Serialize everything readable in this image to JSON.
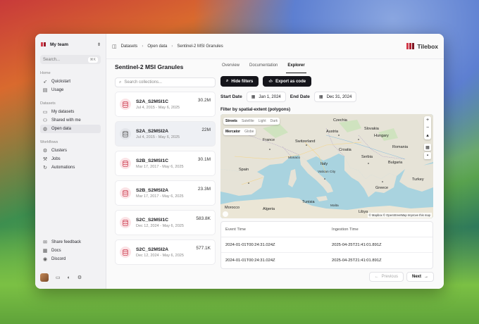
{
  "sidebar": {
    "team": "My team",
    "search_placeholder": "Search...",
    "search_shortcut": "⌘K",
    "sections": [
      {
        "label": "Home",
        "items": [
          {
            "label": "Quickstart",
            "icon": "rocket-icon"
          },
          {
            "label": "Usage",
            "icon": "usage-icon"
          }
        ]
      },
      {
        "label": "Datasets",
        "items": [
          {
            "label": "My datasets",
            "icon": "folder-icon"
          },
          {
            "label": "Shared with me",
            "icon": "users-icon"
          },
          {
            "label": "Open data",
            "icon": "globe-icon"
          }
        ]
      },
      {
        "label": "Workflows",
        "items": [
          {
            "label": "Clusters",
            "icon": "cluster-icon"
          },
          {
            "label": "Jobs",
            "icon": "jobs-icon"
          },
          {
            "label": "Automations",
            "icon": "automation-icon"
          }
        ]
      }
    ],
    "bottom_links": [
      {
        "label": "Share feedback",
        "icon": "feedback-icon"
      },
      {
        "label": "Docs",
        "icon": "docs-icon"
      },
      {
        "label": "Discord",
        "icon": "discord-icon"
      }
    ]
  },
  "breadcrumb": [
    "Datasets",
    "Open data",
    "Sentinel-2 MSI Granules"
  ],
  "brand": "Tilebox",
  "page_title": "Sentinel-2 MSI Granules",
  "collection_search_placeholder": "Search collections...",
  "collections": [
    {
      "name": "S2A_S2MSI1C",
      "dates": "Jul 4, 2015 - May 6, 2025",
      "size": "30.2M"
    },
    {
      "name": "S2A_S2MSI2A",
      "dates": "Jul 4, 2015 - May 6, 2025",
      "size": "22M"
    },
    {
      "name": "S2B_S2MSI1C",
      "dates": "Mar 17, 2017 - May 6, 2025",
      "size": "30.1M"
    },
    {
      "name": "S2B_S2MSI2A",
      "dates": "Mar 17, 2017 - May 6, 2025",
      "size": "23.3M"
    },
    {
      "name": "S2C_S2MSI1C",
      "dates": "Dec 12, 2024 - May 6, 2025",
      "size": "583.8K"
    },
    {
      "name": "S2C_S2MSI2A",
      "dates": "Dec 12, 2024 - May 6, 2025",
      "size": "577.1K"
    }
  ],
  "tabs": [
    "Overview",
    "Documentation",
    "Explorer"
  ],
  "active_tab": "Explorer",
  "buttons": {
    "hide_filters": "Hide filters",
    "export": "Export as code"
  },
  "dates": {
    "start_label": "Start Date",
    "start_value": "Jan 1, 2024",
    "end_label": "End Date",
    "end_value": "Dec 31, 2024"
  },
  "filter_label": "Filter by spatial-extent (polygons)",
  "map": {
    "styles": [
      "Streets",
      "Satellite",
      "Light",
      "Dark"
    ],
    "projections": [
      "Mercator",
      "Globe"
    ],
    "attribution": "© Mapbox © OpenStreetMap Improve this map",
    "labels": [
      "Czechia",
      "Slovakia",
      "Austria",
      "Hungary",
      "France",
      "Switzerland",
      "Romania",
      "Croatia",
      "Serbia",
      "Monaco",
      "Bulgaria",
      "Italy",
      "Spain",
      "Vatican City",
      "Greece",
      "Turkey",
      "Tunisia",
      "Malta",
      "Morocco",
      "Algeria",
      "Libya"
    ]
  },
  "events": {
    "headers": [
      "Event Time",
      "Ingestion Time"
    ],
    "rows": [
      [
        "2024-01-01T00:24:31.024Z",
        "2025-04-25T21:41:01.891Z"
      ],
      [
        "2024-01-01T00:24:31.024Z",
        "2025-04-25T21:41:01.891Z"
      ]
    ]
  },
  "pagination": {
    "prev": "Previous",
    "next": "Next"
  }
}
